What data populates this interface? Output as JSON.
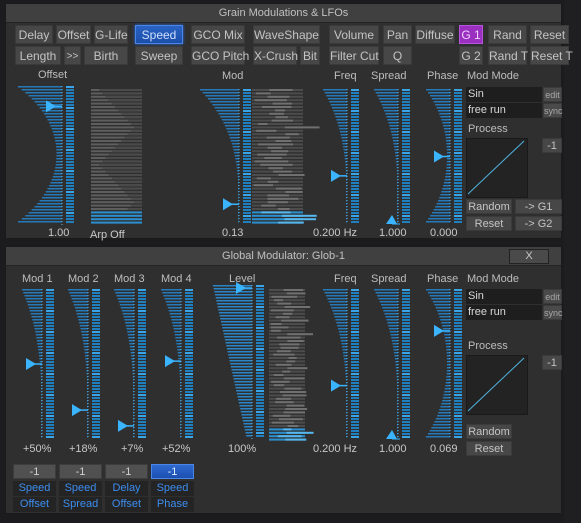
{
  "colors": {
    "accent_blue": "#1f8fd6",
    "slider_fill": "#2a8ed8",
    "handle": "#3ab4ff",
    "button_active_blue": "#2a63c4",
    "button_active_purple": "#9a2fc0",
    "target_label": "#3d8df0"
  },
  "grain_panel": {
    "title": "Grain Modulations & LFOs",
    "buttons_row1": [
      "Delay",
      "Offset",
      "G-Life",
      "Speed",
      "GCO Mix",
      "WaveShape",
      "Volume",
      "Pan",
      "Diffuse",
      "G 1",
      "Rand",
      "Reset"
    ],
    "buttons_row2": [
      "Length",
      ">>",
      "Birth",
      "Sweep",
      "GCO Pitch",
      "X-Crush",
      "Bit",
      "Filter Cut",
      "Q",
      "G 2",
      "Rand T",
      "Reset T"
    ],
    "active_param": "Speed",
    "active_group": "G 1",
    "controls": {
      "offset": {
        "label": "Offset",
        "value": "1.00",
        "position": 0.87
      },
      "arp": {
        "value": "Arp Off"
      },
      "mod": {
        "label": "Mod",
        "value": "0.13",
        "position": 0.13
      },
      "freq": {
        "label": "Freq",
        "value": "0.200 Hz",
        "position": 0.35
      },
      "spread": {
        "label": "Spread",
        "value": "1.000",
        "position": 0.0
      },
      "phase": {
        "label": "Phase",
        "value": "0.000",
        "position": 0.5
      }
    },
    "mod_mode": {
      "label": "Mod Mode",
      "wave": "Sin",
      "edit_label": "edit",
      "run_mode": "free run",
      "sync_label": "sync"
    },
    "process": {
      "label": "Process",
      "invert_label": "-1"
    },
    "random_label": "Random",
    "reset_label": "Reset",
    "to_g1_label": "-> G1",
    "to_g2_label": "-> G2"
  },
  "global_panel": {
    "title": "Global Modulator: Glob-1",
    "close_label": "X",
    "mods": [
      {
        "label": "Mod 1",
        "value": "+50%",
        "position": 0.5,
        "invert_label": "-1",
        "selected": false,
        "target1": "Speed",
        "target2": "Offset"
      },
      {
        "label": "Mod 2",
        "value": "+18%",
        "position": 0.18,
        "invert_label": "-1",
        "selected": false,
        "target1": "Speed",
        "target2": "Spread"
      },
      {
        "label": "Mod 3",
        "value": "+7%",
        "position": 0.07,
        "invert_label": "-1",
        "selected": false,
        "target1": "Delay",
        "target2": "Offset"
      },
      {
        "label": "Mod 4",
        "value": "+52%",
        "position": 0.52,
        "invert_label": "-1",
        "selected": true,
        "target1": "Speed",
        "target2": "Phase"
      }
    ],
    "level": {
      "label": "Level",
      "value": "100%",
      "position": 1.0
    },
    "freq": {
      "label": "Freq",
      "value": "0.200 Hz",
      "position": 0.35
    },
    "spread": {
      "label": "Spread",
      "value": "1.000",
      "position": 0.0
    },
    "phase": {
      "label": "Phase",
      "value": "0.069",
      "position": 0.73
    },
    "mod_mode": {
      "label": "Mod Mode",
      "wave": "Sin",
      "edit_label": "edit",
      "run_mode": "free run",
      "sync_label": "sync"
    },
    "process": {
      "label": "Process",
      "invert_label": "-1"
    },
    "random_label": "Random",
    "reset_label": "Reset"
  }
}
